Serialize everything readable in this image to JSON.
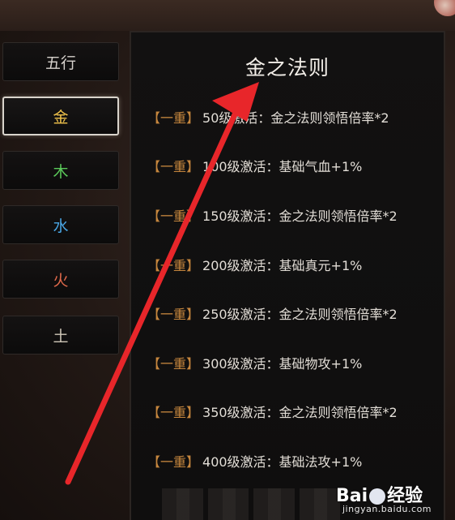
{
  "tabs": [
    {
      "label": "五行",
      "color": "#d6d1cc",
      "active": false
    },
    {
      "label": "金",
      "color": "#f0c24b",
      "active": true
    },
    {
      "label": "木",
      "color": "#5bc95a",
      "active": false
    },
    {
      "label": "水",
      "color": "#4aa7e6",
      "active": false
    },
    {
      "label": "火",
      "color": "#e26a4b",
      "active": false
    },
    {
      "label": "土",
      "color": "#cfc7b8",
      "active": false
    }
  ],
  "panel": {
    "title": "金之法则",
    "rules": [
      {
        "tier": "【一重】",
        "text": "50级激活：金之法则领悟倍率*2"
      },
      {
        "tier": "【一重】",
        "text": "100级激活：基础气血+1%"
      },
      {
        "tier": "【一重】",
        "text": "150级激活：金之法则领悟倍率*2"
      },
      {
        "tier": "【一重】",
        "text": "200级激活：基础真元+1%"
      },
      {
        "tier": "【一重】",
        "text": "250级激活：金之法则领悟倍率*2"
      },
      {
        "tier": "【一重】",
        "text": "300级激活：基础物攻+1%"
      },
      {
        "tier": "【一重】",
        "text": "350级激活：金之法则领悟倍率*2"
      },
      {
        "tier": "【一重】",
        "text": "400级激活：基础法攻+1%"
      }
    ]
  },
  "colors": {
    "tier_accent": "#c7873e",
    "annotation_arrow": "#e8262a"
  },
  "watermark": {
    "logo_left": "Bai",
    "logo_right": "经验",
    "url": "jingyan.baidu.com"
  }
}
